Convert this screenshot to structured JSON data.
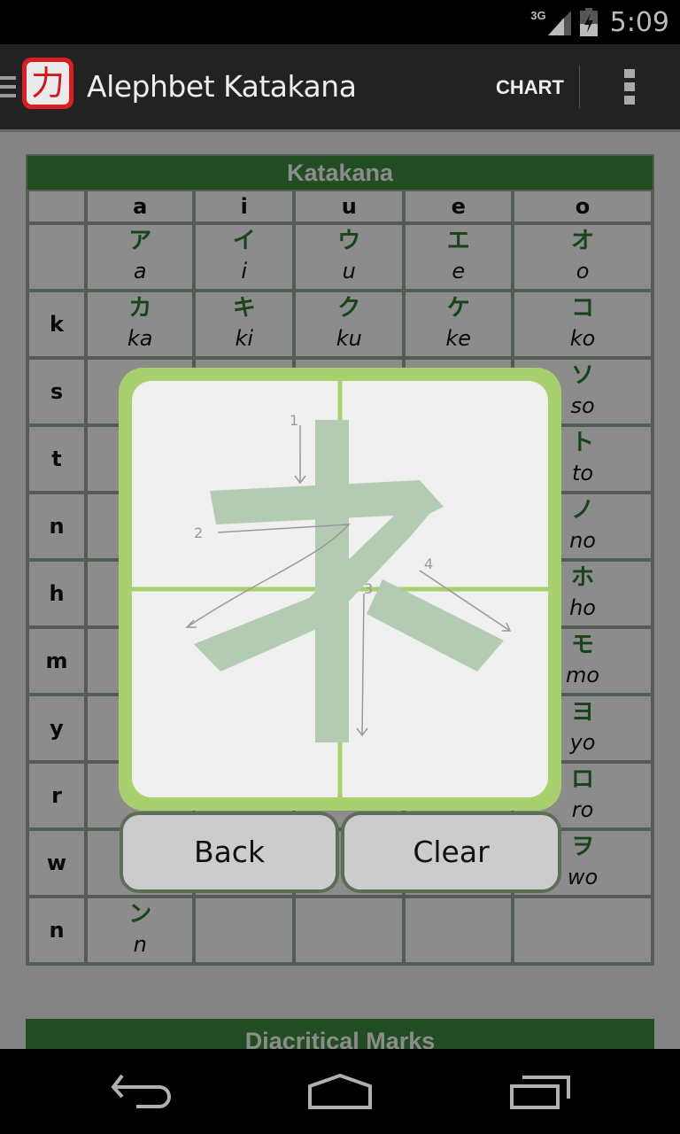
{
  "status_bar": {
    "network": "3G",
    "time": "5:09",
    "icons": [
      "signal-icon",
      "battery-charging-icon"
    ]
  },
  "action_bar": {
    "app_icon_glyph": "力",
    "title": "Alephbet Katakana",
    "chart_label": "CHART",
    "icons": [
      "drawer-icon",
      "app-icon",
      "overflow-menu-icon"
    ]
  },
  "table": {
    "title": "Katakana",
    "columns": [
      "",
      "a",
      "i",
      "u",
      "e",
      "o"
    ],
    "rows": [
      {
        "label": "",
        "cells": [
          {
            "kana": "ア",
            "romaji": "a"
          },
          {
            "kana": "イ",
            "romaji": "i"
          },
          {
            "kana": "ウ",
            "romaji": "u"
          },
          {
            "kana": "エ",
            "romaji": "e"
          },
          {
            "kana": "オ",
            "romaji": "o"
          }
        ]
      },
      {
        "label": "k",
        "cells": [
          {
            "kana": "カ",
            "romaji": "ka"
          },
          {
            "kana": "キ",
            "romaji": "ki"
          },
          {
            "kana": "ク",
            "romaji": "ku"
          },
          {
            "kana": "ケ",
            "romaji": "ke"
          },
          {
            "kana": "コ",
            "romaji": "ko"
          }
        ]
      },
      {
        "label": "s",
        "cells": [
          {
            "kana": "",
            "romaji": ""
          },
          {
            "kana": "",
            "romaji": ""
          },
          {
            "kana": "",
            "romaji": ""
          },
          {
            "kana": "",
            "romaji": ""
          },
          {
            "kana": "ソ",
            "romaji": "so"
          }
        ]
      },
      {
        "label": "t",
        "cells": [
          {
            "kana": "",
            "romaji": ""
          },
          {
            "kana": "",
            "romaji": ""
          },
          {
            "kana": "",
            "romaji": ""
          },
          {
            "kana": "",
            "romaji": ""
          },
          {
            "kana": "ト",
            "romaji": "to"
          }
        ]
      },
      {
        "label": "n",
        "cells": [
          {
            "kana": "",
            "romaji": ""
          },
          {
            "kana": "",
            "romaji": ""
          },
          {
            "kana": "",
            "romaji": ""
          },
          {
            "kana": "",
            "romaji": ""
          },
          {
            "kana": "ノ",
            "romaji": "no"
          }
        ]
      },
      {
        "label": "h",
        "cells": [
          {
            "kana": "",
            "romaji": ""
          },
          {
            "kana": "",
            "romaji": ""
          },
          {
            "kana": "",
            "romaji": ""
          },
          {
            "kana": "",
            "romaji": ""
          },
          {
            "kana": "ホ",
            "romaji": "ho"
          }
        ]
      },
      {
        "label": "m",
        "cells": [
          {
            "kana": "",
            "romaji": ""
          },
          {
            "kana": "",
            "romaji": ""
          },
          {
            "kana": "",
            "romaji": ""
          },
          {
            "kana": "",
            "romaji": ""
          },
          {
            "kana": "モ",
            "romaji": "mo"
          }
        ]
      },
      {
        "label": "y",
        "cells": [
          {
            "kana": "",
            "romaji": ""
          },
          {
            "kana": "",
            "romaji": ""
          },
          {
            "kana": "",
            "romaji": ""
          },
          {
            "kana": "",
            "romaji": ""
          },
          {
            "kana": "ヨ",
            "romaji": "yo"
          }
        ]
      },
      {
        "label": "r",
        "cells": [
          {
            "kana": "",
            "romaji": ""
          },
          {
            "kana": "",
            "romaji": ""
          },
          {
            "kana": "",
            "romaji": ""
          },
          {
            "kana": "",
            "romaji": ""
          },
          {
            "kana": "ロ",
            "romaji": "ro"
          }
        ]
      },
      {
        "label": "w",
        "cells": [
          {
            "kana": "",
            "romaji": ""
          },
          {
            "kana": "",
            "romaji": ""
          },
          {
            "kana": "",
            "romaji": ""
          },
          {
            "kana": "",
            "romaji": ""
          },
          {
            "kana": "ヲ",
            "romaji": "wo"
          }
        ]
      },
      {
        "label": "n",
        "cells": [
          {
            "kana": "ン",
            "romaji": "n"
          },
          {
            "kana": "",
            "romaji": ""
          },
          {
            "kana": "",
            "romaji": ""
          },
          {
            "kana": "",
            "romaji": ""
          },
          {
            "kana": "",
            "romaji": ""
          }
        ]
      }
    ]
  },
  "diacritics": {
    "title": "Diacritical Marks"
  },
  "stroke_dialog": {
    "character": "ネ",
    "stroke_numbers": [
      "1",
      "2",
      "3",
      "4"
    ],
    "back_label": "Back",
    "clear_label": "Clear"
  },
  "nav_bar": {
    "icons": [
      "back-icon",
      "home-icon",
      "recents-icon"
    ]
  },
  "colors": {
    "header_green": "#3f8a3f",
    "kana_green": "#2e7d32",
    "dialog_border": "#a8d06e",
    "stroke_fill": "#b3cbb3",
    "button_border": "#5d6e55"
  }
}
